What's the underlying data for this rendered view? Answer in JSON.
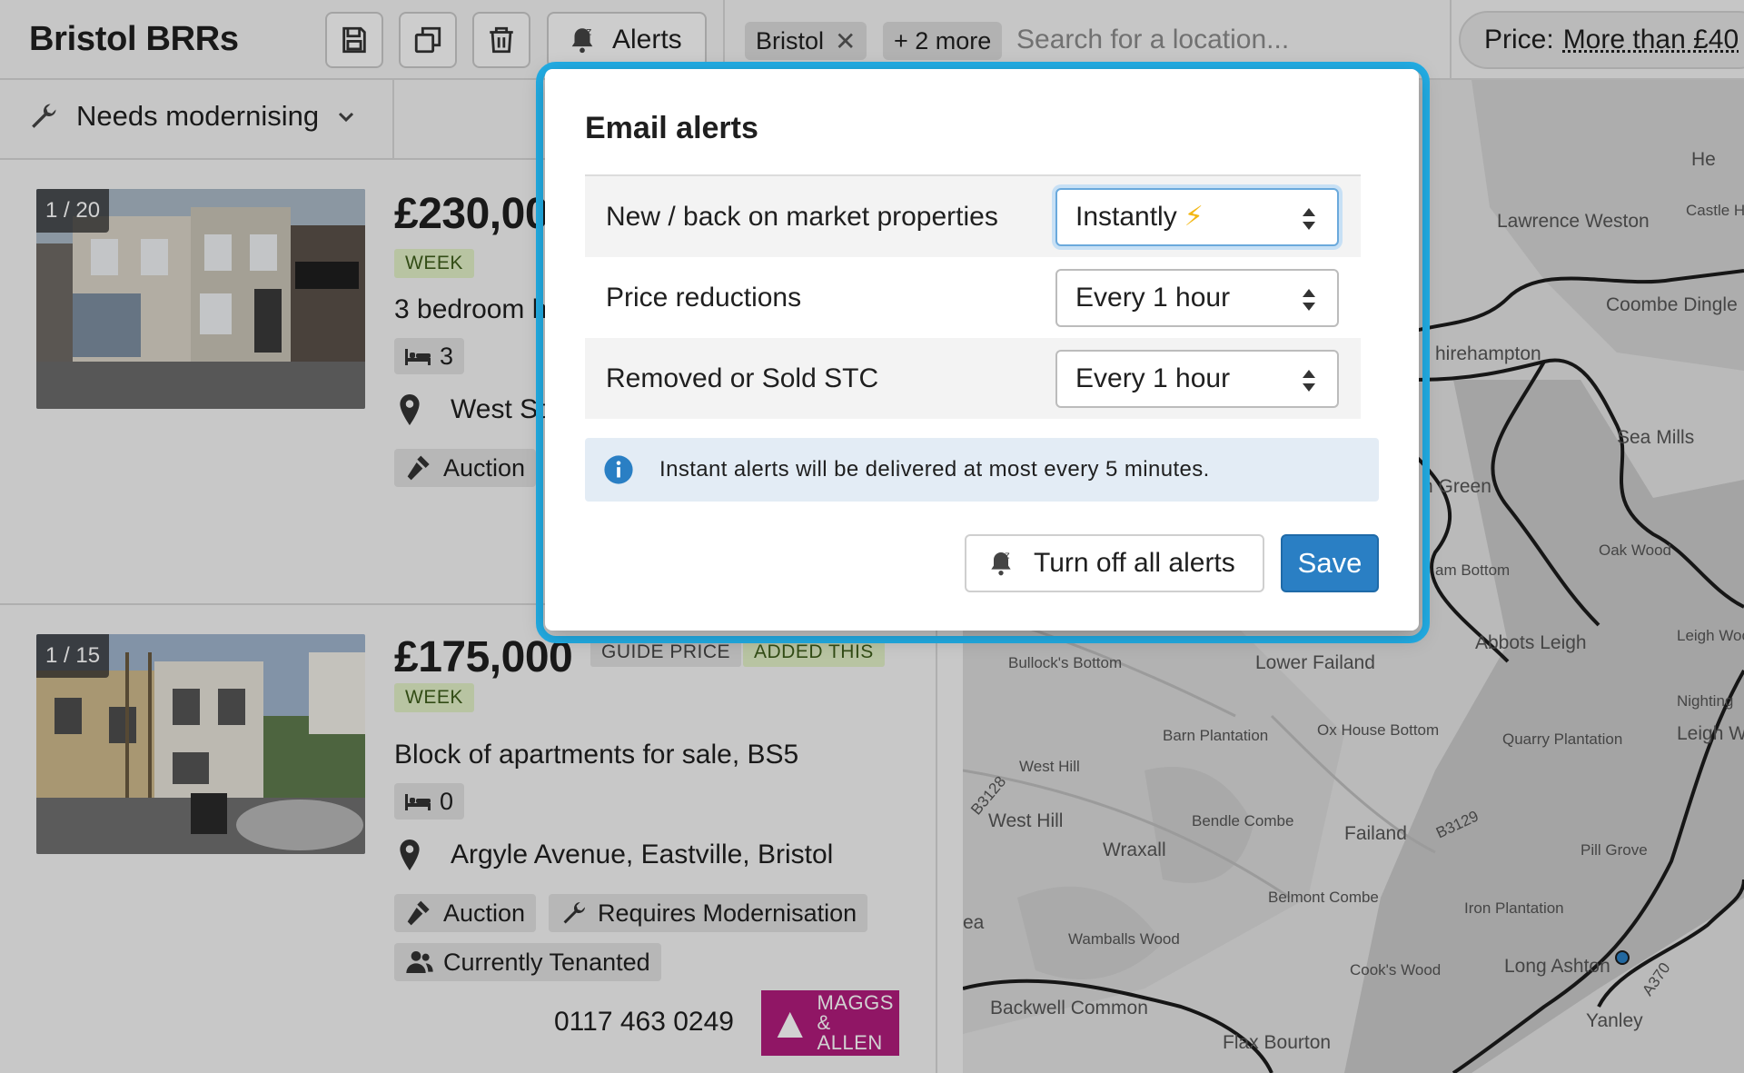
{
  "app": {
    "title": "Bristol BRRs"
  },
  "toolbar": {
    "alerts_label": "Alerts"
  },
  "location_filter": {
    "chips": [
      {
        "label": "Bristol"
      },
      {
        "label": "+ 2 more"
      }
    ],
    "placeholder": "Search for a location..."
  },
  "price_filter": {
    "label": "Price:",
    "value": "More than £40"
  },
  "condition_filter": {
    "label": "Needs modernising"
  },
  "listings": [
    {
      "image_count": "1 / 20",
      "price": "£230,00",
      "tags": [
        "WEEK"
      ],
      "title": "3 bedroom h",
      "beds": "3",
      "location": "West St",
      "features": [
        "Auction"
      ]
    },
    {
      "image_count": "1 / 15",
      "price": "£175,000",
      "tags": [
        "GUIDE PRICE",
        "ADDED THIS",
        "WEEK"
      ],
      "title": "Block of apartments for sale, BS5",
      "beds": "0",
      "location": "Argyle Avenue, Eastville, Bristol",
      "features": [
        "Auction",
        "Requires Modernisation",
        "Currently Tenanted"
      ],
      "phone": "0117 463 0249",
      "agent_logo": "MAGGS & ALLEN"
    }
  ],
  "map": {
    "labels": [
      "He",
      "Castle H",
      "Lawrence Weston",
      "Coombe Dingle",
      "hirehampton",
      "Sea Mills",
      "n Green",
      "Oak Wood",
      "am Bottom",
      "Abbots Leigh",
      "Leigh Woo",
      "Nighting",
      "Leigh W",
      "Bullock's Bottom",
      "Lower Failand",
      "Barn Plantation",
      "Ox House Bottom",
      "Quarry Plantation",
      "West Hill",
      "West Hill",
      "B3128",
      "Bendle Combe",
      "Failand",
      "B3129",
      "Wraxall",
      "Pill Grove",
      "Belmont Combe",
      "Iron Plantation",
      "ea",
      "Wamballs Wood",
      "Cook's Wood",
      "Long Ashton",
      "A370",
      "Backwell Common",
      "Flax Bourton",
      "Yanley"
    ]
  },
  "modal": {
    "title": "Email alerts",
    "rows": [
      {
        "label": "New / back on market properties",
        "value": "Instantly",
        "accent": "⚡"
      },
      {
        "label": "Price reductions",
        "value": "Every 1 hour"
      },
      {
        "label": "Removed or Sold STC",
        "value": "Every 1 hour"
      }
    ],
    "info": "Instant alerts will be delivered at most every 5 minutes.",
    "turn_off_label": "Turn off all alerts",
    "save_label": "Save"
  },
  "colors": {
    "focus_ring": "#22aee6",
    "primary_button": "#2a7fc4",
    "info_background": "#e3ecf5",
    "week_tag": "#e1efc6",
    "agent_brand": "#b01c7c",
    "bolt": "#f3b714"
  }
}
